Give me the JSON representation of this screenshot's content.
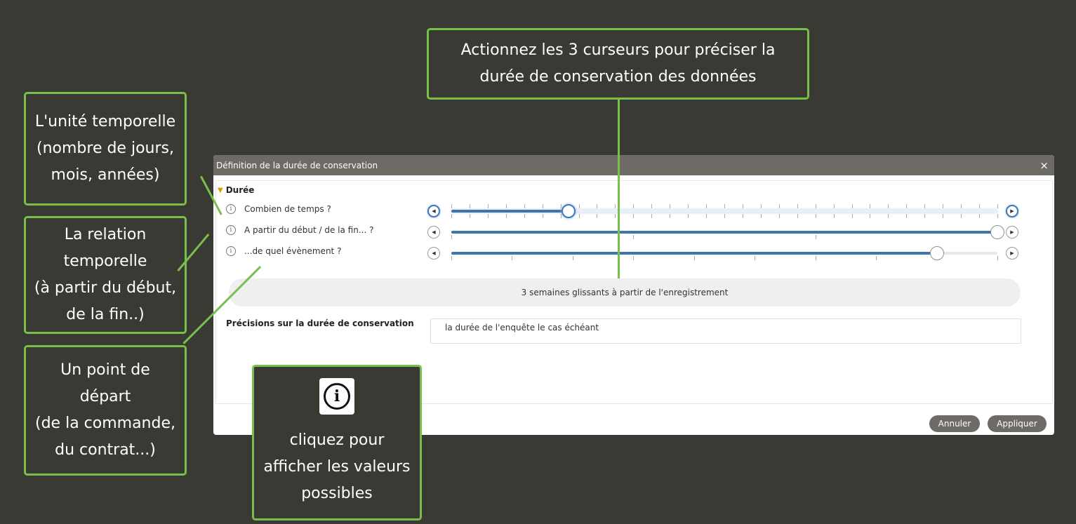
{
  "callouts": {
    "top": [
      "Actionnez les 3 curseurs pour préciser la",
      "durée de conservation des données"
    ],
    "unit": [
      "L'unité temporelle",
      "(nombre de jours,",
      "mois, années)"
    ],
    "relation": [
      "La relation",
      "temporelle",
      "(à partir du début,",
      "de la fin..)"
    ],
    "start": [
      "Un point de",
      "départ",
      "(de la commande,",
      "du contrat...)"
    ],
    "info": [
      "cliquez pour",
      "afficher les valeurs",
      "possibles"
    ]
  },
  "dialog": {
    "title": "Définition de la durée de conservation",
    "close": "×",
    "section": "Durée",
    "rows": [
      {
        "label": "Combien de temps ?",
        "value": 0.215
      },
      {
        "label": "A partir du début / de la fin... ?",
        "value": 1.0
      },
      {
        "label": "...de quel évènement ?",
        "value": 0.89
      }
    ],
    "summary": "3 semaines glissants à partir de l'enregistrement",
    "precision_label": "Précisions sur la durée de conservation",
    "precision_value": "la durée de l'enquête le cas échéant",
    "cancel": "Annuler",
    "apply": "Appliquer"
  },
  "colors": {
    "accent": "#79c04a",
    "slider": "#3e75ae",
    "background": "#393a33"
  },
  "icons": [
    "info-icon",
    "arrow-left-icon",
    "arrow-right-icon",
    "close-icon",
    "chevron-down-icon"
  ]
}
